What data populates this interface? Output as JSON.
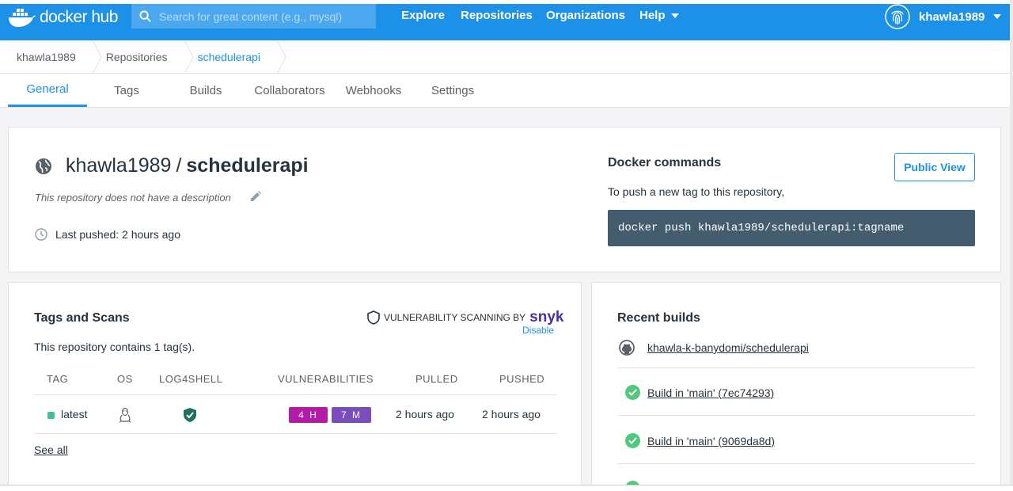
{
  "navbar": {
    "logo_text": "docker hub",
    "logo_bold": "hub",
    "logo_main": "docker",
    "search_placeholder": "Search for great content (e.g., mysql)",
    "links": [
      "Explore",
      "Repositories",
      "Organizations",
      "Help"
    ],
    "username": "khawla1989"
  },
  "breadcrumb": [
    "khawla1989",
    "Repositories",
    "schedulerapi"
  ],
  "tabs": [
    "General",
    "Tags",
    "Builds",
    "Collaborators",
    "Webhooks",
    "Settings"
  ],
  "active_tab": "General",
  "repo": {
    "namespace": "khawla1989",
    "separator": "/",
    "name": "schedulerapi",
    "description": "This repository does not have a description",
    "last_pushed": "Last pushed: 2 hours ago"
  },
  "docker_commands": {
    "title": "Docker commands",
    "subtitle": "To push a new tag to this repository,",
    "command": "docker push khawla1989/schedulerapi:tagname",
    "public_view": "Public View"
  },
  "tags_scans": {
    "title": "Tags and Scans",
    "vuln_label": "VULNERABILITY SCANNING BY",
    "vendor": "snyk",
    "disable": "Disable",
    "count_text": "This repository contains 1 tag(s).",
    "headers": [
      "TAG",
      "OS",
      "LOG4SHELL",
      "VULNERABILITIES",
      "PULLED",
      "PUSHED"
    ],
    "rows": [
      {
        "tag": "latest",
        "high": "4 H",
        "medium": "7 M",
        "pulled": "2 hours ago",
        "pushed": "2 hours ago"
      }
    ],
    "see_all": "See all"
  },
  "recent_builds": {
    "title": "Recent builds",
    "repo_link": "khawla-k-banydomi/schedulerapi",
    "builds": [
      "Build in 'main' (7ec74293)",
      "Build in 'main' (9069da8d)"
    ]
  },
  "colors": {
    "brand": "#1d91e8",
    "command_bg": "#445d6e",
    "high": "#b41ca8",
    "medium": "#7a4dbd",
    "success": "#52c87a"
  }
}
